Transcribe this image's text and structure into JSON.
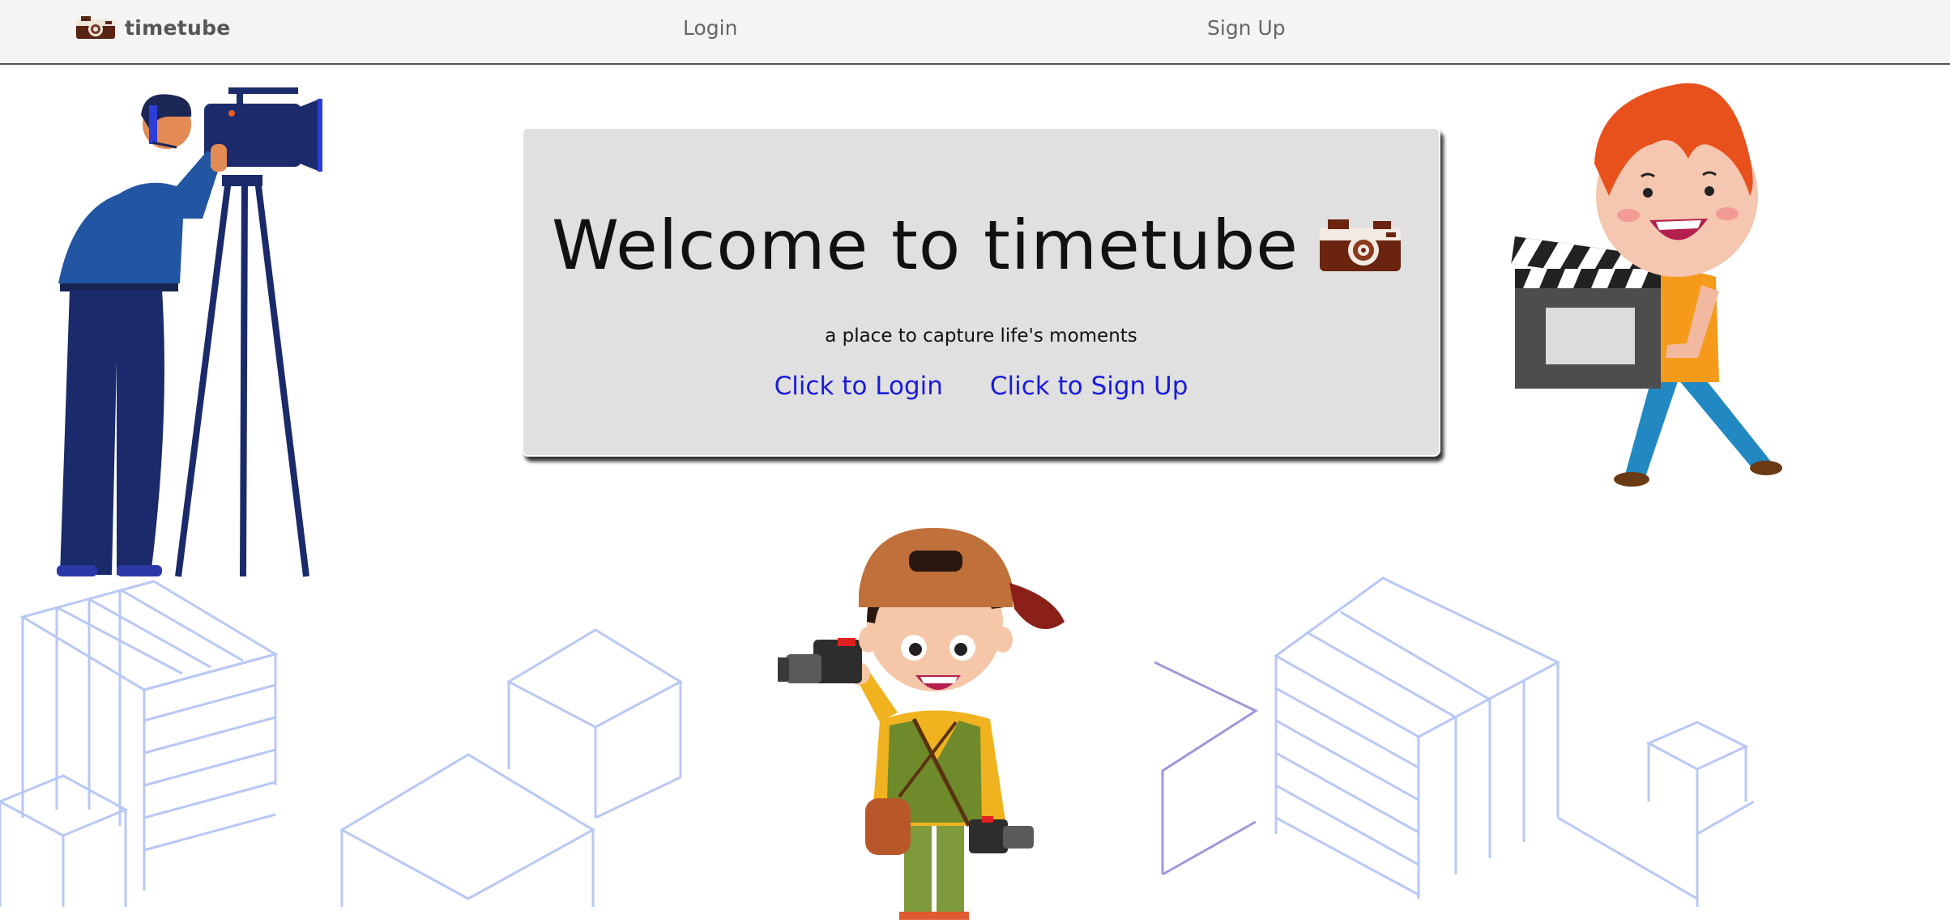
{
  "navbar": {
    "brand": "timetube",
    "links": {
      "login": "Login",
      "signup": "Sign Up"
    }
  },
  "hero": {
    "title": "Welcome to timetube",
    "tagline": "a place to capture life's moments",
    "login_link": "Click to Login",
    "signup_link": "Click to Sign Up"
  },
  "icons": {
    "logo": "camera-icon",
    "title_icon": "camera-icon"
  },
  "colors": {
    "navbar_bg": "#f4f4f4",
    "card_bg": "#e0e0e0",
    "link": "#1a1adc",
    "cube_lines": "#b8c8f5"
  }
}
